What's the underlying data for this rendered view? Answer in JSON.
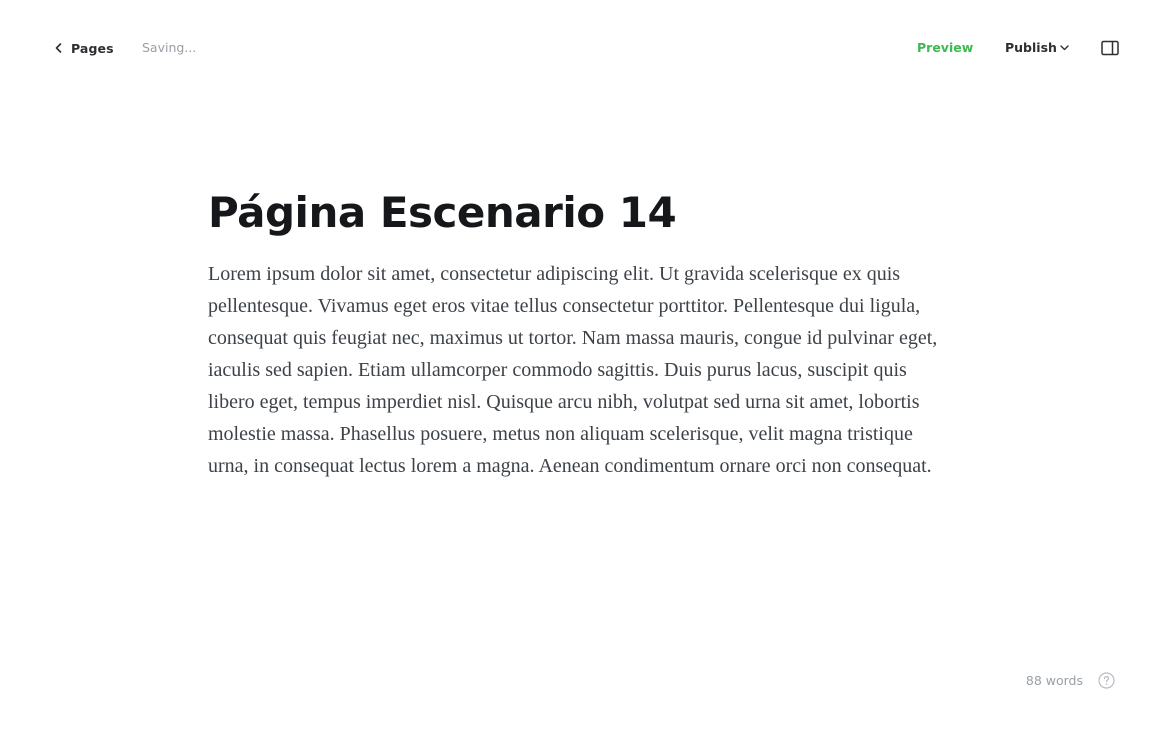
{
  "header": {
    "back_label": "Pages",
    "status": "Saving...",
    "preview_label": "Preview",
    "publish_label": "Publish",
    "accent_color": "#3db94f",
    "icons": {
      "back": "chevron-left-icon",
      "publish_dropdown": "chevron-down-icon",
      "settings": "sidebar-panel-icon"
    }
  },
  "editor": {
    "title": "Página Escenario 14",
    "lines": [
      "Lorem ipsum dolor sit amet, consectetur adipiscing elit. Ut gravida scelerisque ex quis",
      "pellentesque. Vivamus eget eros vitae tellus consectetur porttitor. Pellentesque dui ligula,",
      "consequat quis feugiat nec, maximus ut tortor. Nam massa mauris, congue id pulvinar eget,",
      "iaculis sed sapien. Etiam ullamcorper commodo sagittis. Duis purus lacus, suscipit quis",
      "libero eget, tempus imperdiet nisl. Quisque arcu nibh, volutpat sed urna sit amet, lobortis",
      "molestie massa. Phasellus posuere, metus non aliquam scelerisque, velit magna tristique",
      "urna, in consequat lectus lorem a magna. Aenean condimentum ornare orci non consequat."
    ]
  },
  "footer": {
    "word_count": "88 words",
    "help_icon": "question-circle-icon"
  }
}
